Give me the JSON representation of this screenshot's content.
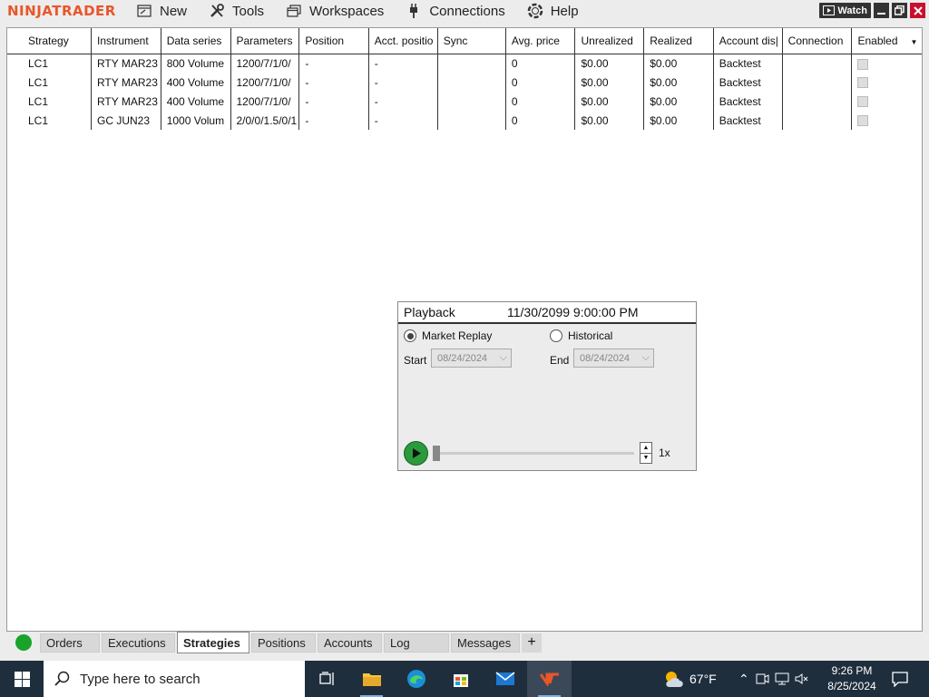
{
  "app": {
    "logo": "NINJATRADER",
    "menu": [
      {
        "label": "New",
        "icon": "new-window-icon"
      },
      {
        "label": "Tools",
        "icon": "tools-icon"
      },
      {
        "label": "Workspaces",
        "icon": "workspaces-icon"
      },
      {
        "label": "Connections",
        "icon": "connections-plug-icon"
      },
      {
        "label": "Help",
        "icon": "help-lifebuoy-icon"
      }
    ],
    "watch_label": "Watch"
  },
  "grid": {
    "columns": [
      "Strategy",
      "Instrument",
      "Data series",
      "Parameters",
      "Position",
      "Acct. positio",
      "Sync",
      "Avg. price",
      "Unrealized",
      "Realized",
      "Account dis|",
      "Connection",
      "Enabled"
    ],
    "rows": [
      [
        "LC1",
        "RTY MAR23",
        "800 Volume",
        "1200/7/1/0/",
        "-",
        "-",
        "",
        "0",
        "$0.00",
        "$0.00",
        "Backtest",
        ""
      ],
      [
        "LC1",
        "RTY MAR23",
        "400 Volume",
        "1200/7/1/0/",
        "-",
        "-",
        "",
        "0",
        "$0.00",
        "$0.00",
        "Backtest",
        ""
      ],
      [
        "LC1",
        "RTY MAR23",
        "400 Volume",
        "1200/7/1/0/",
        "-",
        "-",
        "",
        "0",
        "$0.00",
        "$0.00",
        "Backtest",
        ""
      ],
      [
        "LC1",
        "GC JUN23",
        "1000 Volum",
        "2/0/0/1.5/0/1",
        "-",
        "-",
        "",
        "0",
        "$0.00",
        "$0.00",
        "Backtest",
        ""
      ]
    ]
  },
  "playback": {
    "title": "Playback",
    "time": "11/30/2099 9:00:00 PM",
    "market_replay_label": "Market Replay",
    "historical_label": "Historical",
    "start_label": "Start",
    "end_label": "End",
    "start_date": "08/24/2024",
    "end_date": "08/24/2024",
    "speed": "1x",
    "mode_selected": "Market Replay"
  },
  "tabs": [
    "Orders",
    "Executions",
    "Strategies",
    "Positions",
    "Accounts",
    "Log",
    "Messages"
  ],
  "active_tab": "Strategies",
  "taskbar": {
    "search_placeholder": "Type here to search",
    "temperature": "67°F",
    "time": "9:26 PM",
    "date": "8/25/2024"
  },
  "colors": {
    "logo": "#e8562a",
    "status_connected": "#1aa32a",
    "play_button": "#2a9a3c",
    "close_button": "#c8102e",
    "taskbar": "#1f2e3d"
  }
}
